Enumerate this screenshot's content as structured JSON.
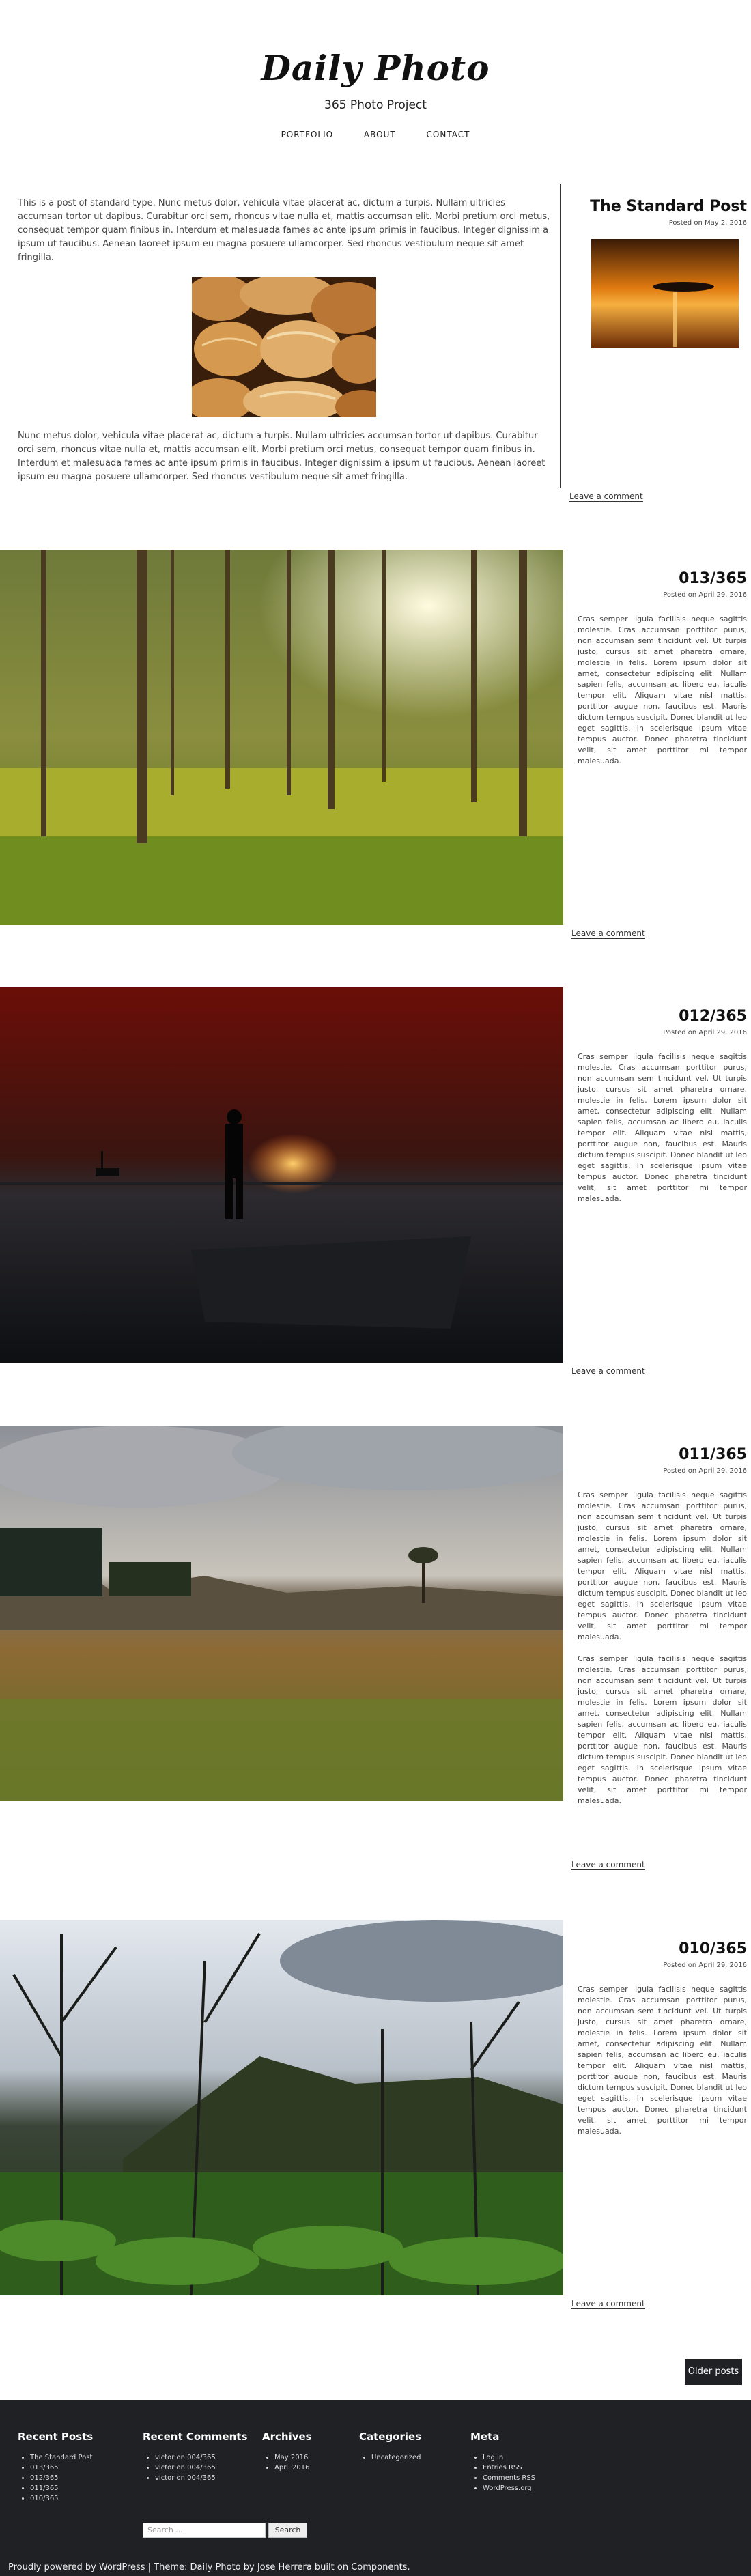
{
  "site": {
    "title": "Daily Photo",
    "description": "365 Photo Project"
  },
  "nav": {
    "items": [
      "PORTFOLIO",
      "ABOUT",
      "CONTACT"
    ]
  },
  "sticky_post": {
    "title": "The Standard Post",
    "meta": "Posted on May 2, 2016",
    "para1": "This is a post of standard-type. Nunc metus dolor, vehicula vitae placerat ac, dictum a turpis. Nullam ultricies accumsan tortor ut dapibus. Curabitur orci sem, rhoncus vitae nulla et, mattis accumsan elit. Morbi pretium orci metus, consequat tempor quam finibus in. Interdum et malesuada fames ac ante ipsum primis in faucibus. Integer dignissim a ipsum ut faucibus. Aenean laoreet ipsum eu magna posuere ullamcorper. Sed rhoncus vestibulum neque sit amet fringilla.",
    "para2": "Nunc metus dolor, vehicula vitae placerat ac, dictum a turpis. Nullam ultricies accumsan tortor ut dapibus. Curabitur orci sem, rhoncus vitae nulla et, mattis accumsan elit. Morbi pretium orci metus, consequat tempor quam finibus in. Interdum et malesuada fames ac ante ipsum primis in faucibus. Integer dignissim a ipsum ut faucibus. Aenean laoreet ipsum eu magna posuere ullamcorper. Sed rhoncus vestibulum neque sit amet fringilla.",
    "comment_link": "Leave a comment"
  },
  "posts": [
    {
      "title": "013/365",
      "meta": "Posted on April 29, 2016",
      "paragraphs": [
        "Cras semper ligula facilisis neque sagittis molestie. Cras accumsan porttitor purus, non accumsan sem tincidunt vel. Ut turpis justo, cursus sit amet pharetra ornare, molestie in felis. Lorem ipsum dolor sit amet, consectetur adipiscing elit. Nullam sapien felis, accumsan ac libero eu, iaculis tempor elit. Aliquam vitae nisl mattis, porttitor augue non, faucibus est. Mauris dictum tempus suscipit. Donec blandit ut leo eget sagittis. In scelerisque ipsum vitae tempus auctor. Donec pharetra tincidunt velit, sit amet porttitor mi tempor malesuada."
      ],
      "comment_link": "Leave a comment"
    },
    {
      "title": "012/365",
      "meta": "Posted on April 29, 2016",
      "paragraphs": [
        "Cras semper ligula facilisis neque sagittis molestie. Cras accumsan porttitor purus, non accumsan sem tincidunt vel. Ut turpis justo, cursus sit amet pharetra ornare, molestie in felis. Lorem ipsum dolor sit amet, consectetur adipiscing elit. Nullam sapien felis, accumsan ac libero eu, iaculis tempor elit. Aliquam vitae nisl mattis, porttitor augue non, faucibus est. Mauris dictum tempus suscipit. Donec blandit ut leo eget sagittis. In scelerisque ipsum vitae tempus auctor. Donec pharetra tincidunt velit, sit amet porttitor mi tempor malesuada."
      ],
      "comment_link": "Leave a comment"
    },
    {
      "title": "011/365",
      "meta": "Posted on April 29, 2016",
      "paragraphs": [
        "Cras semper ligula facilisis neque sagittis molestie. Cras accumsan porttitor purus, non accumsan sem tincidunt vel. Ut turpis justo, cursus sit amet pharetra ornare, molestie in felis. Lorem ipsum dolor sit amet, consectetur adipiscing elit. Nullam sapien felis, accumsan ac libero eu, iaculis tempor elit. Aliquam vitae nisl mattis, porttitor augue non, faucibus est. Mauris dictum tempus suscipit. Donec blandit ut leo eget sagittis. In scelerisque ipsum vitae tempus auctor. Donec pharetra tincidunt velit, sit amet porttitor mi tempor malesuada.",
        "Cras semper ligula facilisis neque sagittis molestie. Cras accumsan porttitor purus, non accumsan sem tincidunt vel. Ut turpis justo, cursus sit amet pharetra ornare, molestie in felis. Lorem ipsum dolor sit amet, consectetur adipiscing elit. Nullam sapien felis, accumsan ac libero eu, iaculis tempor elit. Aliquam vitae nisl mattis, porttitor augue non, faucibus est. Mauris dictum tempus suscipit. Donec blandit ut leo eget sagittis. In scelerisque ipsum vitae tempus auctor. Donec pharetra tincidunt velit, sit amet porttitor mi tempor malesuada."
      ],
      "comment_link": "Leave a comment"
    },
    {
      "title": "010/365",
      "meta": "Posted on April 29, 2016",
      "paragraphs": [
        "Cras semper ligula facilisis neque sagittis molestie. Cras accumsan porttitor purus, non accumsan sem tincidunt vel. Ut turpis justo, cursus sit amet pharetra ornare, molestie in felis. Lorem ipsum dolor sit amet, consectetur adipiscing elit. Nullam sapien felis, accumsan ac libero eu, iaculis tempor elit. Aliquam vitae nisl mattis, porttitor augue non, faucibus est. Mauris dictum tempus suscipit. Donec blandit ut leo eget sagittis. In scelerisque ipsum vitae tempus auctor. Donec pharetra tincidunt velit, sit amet porttitor mi tempor malesuada."
      ],
      "comment_link": "Leave a comment"
    }
  ],
  "pagination": {
    "older_label": "Older posts"
  },
  "footer": {
    "recent_posts": {
      "title": "Recent Posts",
      "items": [
        "The Standard Post",
        "013/365",
        "012/365",
        "011/365",
        "010/365"
      ]
    },
    "recent_comments": {
      "title": "Recent Comments",
      "items": [
        "victor on 004/365",
        "victor on 004/365",
        "victor on 004/365"
      ]
    },
    "archives": {
      "title": "Archives",
      "items": [
        "May 2016",
        "April 2016"
      ]
    },
    "categories": {
      "title": "Categories",
      "items": [
        "Uncategorized"
      ]
    },
    "meta": {
      "title": "Meta",
      "items": [
        "Log in",
        "Entries RSS",
        "Comments RSS",
        "WordPress.org"
      ]
    },
    "search": {
      "placeholder": "Search ...",
      "button": "Search"
    },
    "credits": "Proudly powered by WordPress | Theme: Daily Photo by Jose Herrera built on Components."
  },
  "colors": {
    "footer_bg": "#1f2125",
    "text": "#333333"
  }
}
